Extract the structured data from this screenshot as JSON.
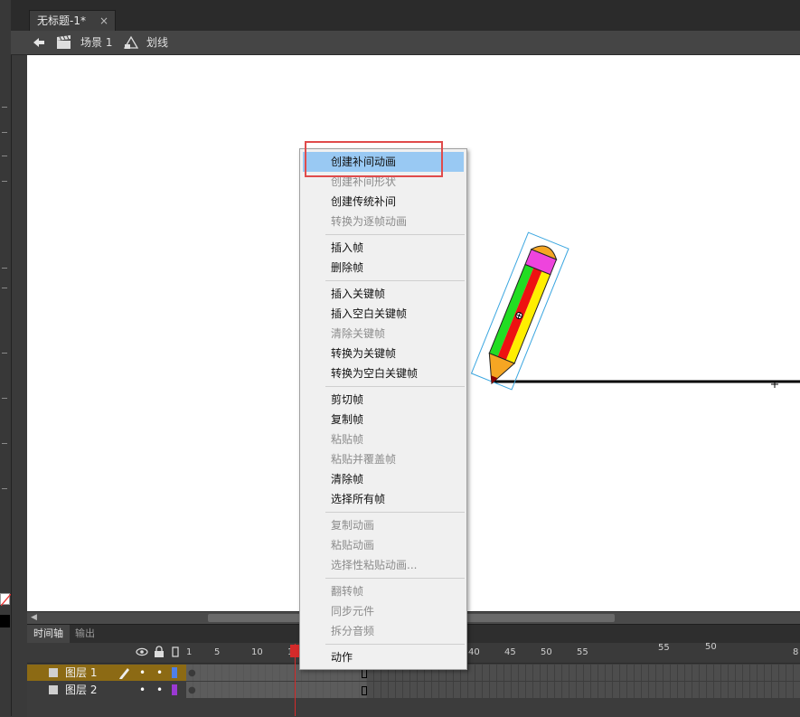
{
  "document_tab": {
    "title": "无标题-1*",
    "close": "×"
  },
  "edit_bar": {
    "scene_label": "场景 1",
    "symbol_label": "划线"
  },
  "timeline": {
    "tabs": [
      "时间轴",
      "输出"
    ],
    "ruler": [
      "1",
      "5",
      "10",
      "15",
      "40",
      "45",
      "50",
      "55",
      "55",
      "50",
      "8"
    ],
    "layers": [
      {
        "name": "图层 1",
        "color": "#4f7fe8",
        "selected": true
      },
      {
        "name": "图层 2",
        "color": "#9b39d2",
        "selected": false
      }
    ]
  },
  "context_menu": {
    "groups": [
      [
        {
          "label": "创建补间动画",
          "enabled": true,
          "highlighted": true
        },
        {
          "label": "创建补间形状",
          "enabled": false
        },
        {
          "label": "创建传统补间",
          "enabled": true
        },
        {
          "label": "转换为逐帧动画",
          "enabled": false
        }
      ],
      [
        {
          "label": "插入帧",
          "enabled": true
        },
        {
          "label": "删除帧",
          "enabled": true
        }
      ],
      [
        {
          "label": "插入关键帧",
          "enabled": true
        },
        {
          "label": "插入空白关键帧",
          "enabled": true
        },
        {
          "label": "清除关键帧",
          "enabled": false
        },
        {
          "label": "转换为关键帧",
          "enabled": true
        },
        {
          "label": "转换为空白关键帧",
          "enabled": true
        }
      ],
      [
        {
          "label": "剪切帧",
          "enabled": true
        },
        {
          "label": "复制帧",
          "enabled": true
        },
        {
          "label": "粘贴帧",
          "enabled": false
        },
        {
          "label": "粘贴并覆盖帧",
          "enabled": false
        },
        {
          "label": "清除帧",
          "enabled": true
        },
        {
          "label": "选择所有帧",
          "enabled": true
        }
      ],
      [
        {
          "label": "复制动画",
          "enabled": false
        },
        {
          "label": "粘贴动画",
          "enabled": false
        },
        {
          "label": "选择性粘贴动画...",
          "enabled": false
        }
      ],
      [
        {
          "label": "翻转帧",
          "enabled": false
        },
        {
          "label": "同步元件",
          "enabled": false
        },
        {
          "label": "拆分音频",
          "enabled": false
        }
      ],
      [
        {
          "label": "动作",
          "enabled": true
        }
      ]
    ]
  },
  "colors": {
    "accent": "#99c9f3",
    "annotation": "#e04b4b",
    "pencil_green": "#22dd22",
    "pencil_red": "#ee1111",
    "pencil_yellow": "#ffee00",
    "pencil_cap": "#ee44dd",
    "pencil_tip": "#f5a623"
  }
}
